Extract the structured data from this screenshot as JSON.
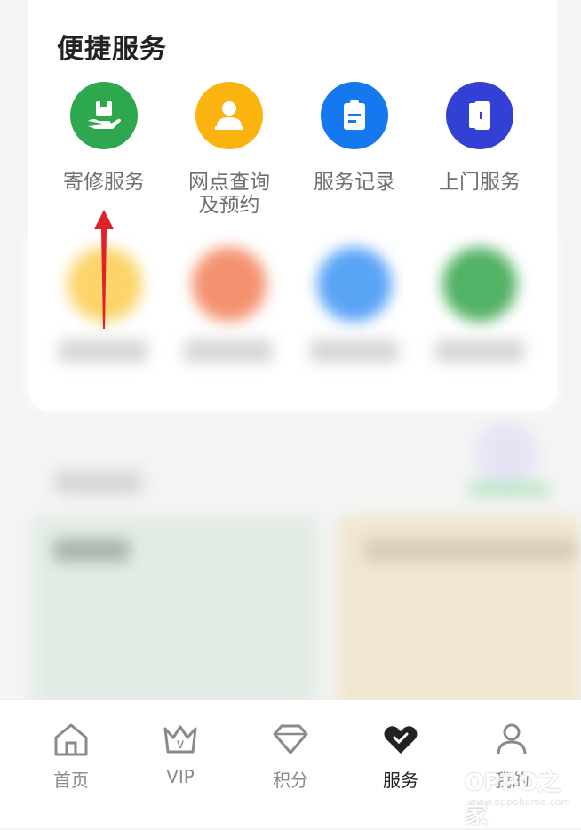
{
  "quick_services": {
    "title": "便捷服务",
    "items": [
      {
        "label": "寄修服务",
        "icon": "package-hand-icon",
        "color": "#2ea84f"
      },
      {
        "label": "网点查询\n及预约",
        "icon": "service-agent-icon",
        "color": "#fbb40f"
      },
      {
        "label": "服务记录",
        "icon": "clipboard-icon",
        "color": "#1678ee"
      },
      {
        "label": "上门服务",
        "icon": "door-icon",
        "color": "#3340d6"
      }
    ]
  },
  "bottom_nav": {
    "items": [
      {
        "label": "首页",
        "icon": "home-icon"
      },
      {
        "label": "VIP",
        "icon": "crown-icon"
      },
      {
        "label": "积分",
        "icon": "diamond-icon"
      },
      {
        "label": "服务",
        "icon": "heart-check-icon",
        "active": true
      },
      {
        "label": "我的",
        "icon": "user-icon"
      }
    ]
  },
  "watermark": {
    "text": "OPPO之家",
    "sub": "www.oppohome.com"
  },
  "colors": {
    "accent": "#2ea84f",
    "arrow": "#e0202a"
  }
}
